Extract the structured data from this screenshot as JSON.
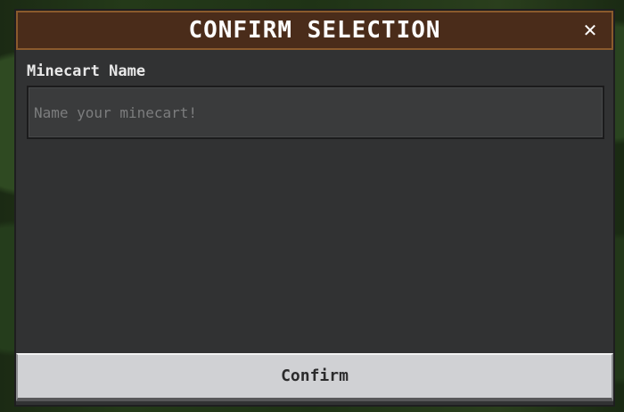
{
  "dialog": {
    "title": "CONFIRM SELECTION",
    "close_icon": "close-icon",
    "close_glyph": "✕",
    "field": {
      "label": "Minecart Name",
      "value": "",
      "placeholder": "Name your minecart!"
    },
    "confirm_label": "Confirm"
  },
  "colors": {
    "title_bar": "#4a2c1a",
    "title_border": "#8a5a2c",
    "panel": "#313233",
    "button": "#d0d1d4"
  }
}
